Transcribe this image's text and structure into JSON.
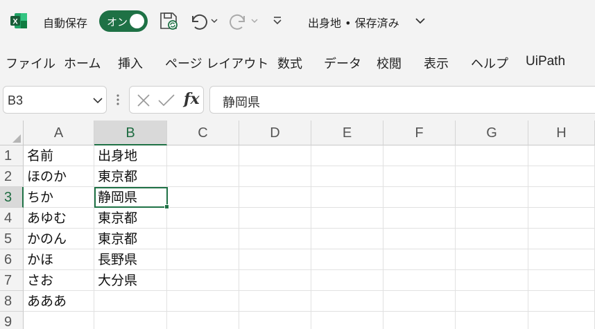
{
  "titlebar": {
    "autosave_label": "自動保存",
    "autosave_toggle": "オン",
    "doc_title": "出身地 • 保存済み"
  },
  "ribbon": {
    "tabs": [
      "ファイル",
      "ホーム",
      "挿入",
      "ページ レイアウト",
      "数式",
      "データ",
      "校閲",
      "表示",
      "ヘルプ",
      "UiPath"
    ]
  },
  "formula_bar": {
    "name_box": "B3",
    "formula": "静岡県"
  },
  "sheet": {
    "columns": [
      "A",
      "B",
      "C",
      "D",
      "E",
      "F",
      "G",
      "H"
    ],
    "rows": [
      "1",
      "2",
      "3",
      "4",
      "5",
      "6",
      "7",
      "8",
      "9"
    ],
    "col_a": [
      "名前",
      "ほのか",
      "ちか",
      "あゆむ",
      "かのん",
      "かほ",
      "さお",
      "あああ",
      ""
    ],
    "col_b": [
      "出身地",
      "東京都",
      "静岡県",
      "東京都",
      "東京都",
      "長野県",
      "大分県",
      "",
      ""
    ],
    "selected_cell": "B3"
  },
  "colors": {
    "excel_green": "#1e7145",
    "ribbon_bg": "#f3f3f3"
  },
  "icons": [
    "excel-logo-icon",
    "save-icon",
    "undo-icon",
    "redo-icon",
    "customize-qat-icon",
    "chevron-down-icon",
    "cancel-icon",
    "enter-icon",
    "fx-icon"
  ]
}
